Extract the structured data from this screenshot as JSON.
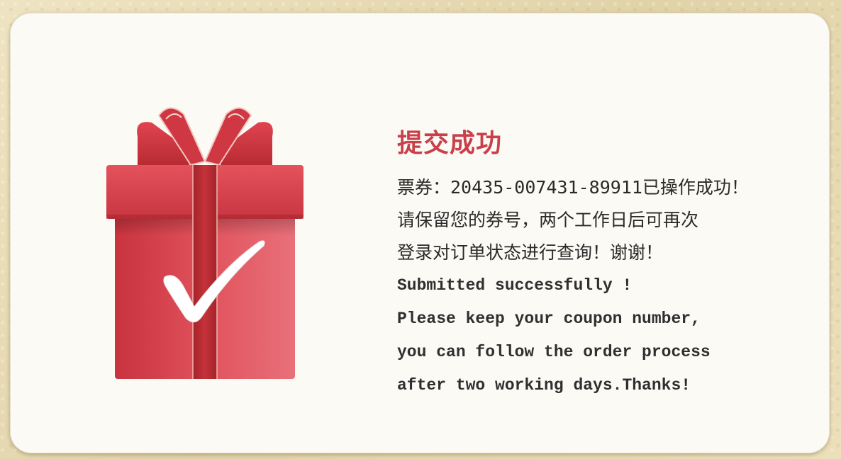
{
  "dialog": {
    "title": "提交成功",
    "message_cn": [
      "票券：20435-007431-89911已操作成功！",
      "请保留您的券号，两个工作日后可再次",
      "登录对订单状态进行查询！谢谢！"
    ],
    "message_en": [
      "Submitted successfully !",
      "Please keep your coupon number,",
      "you can follow the order process",
      "after two working days.Thanks!"
    ]
  },
  "icons": {
    "gift": "gift-box-icon",
    "check": "checkmark-icon"
  },
  "colors": {
    "title": "#c9404a",
    "gift_red": "#d9424c",
    "ribbon": "#b82a2f",
    "card_bg": "#fbfaf5",
    "page_bg": "#e6d9b2"
  }
}
